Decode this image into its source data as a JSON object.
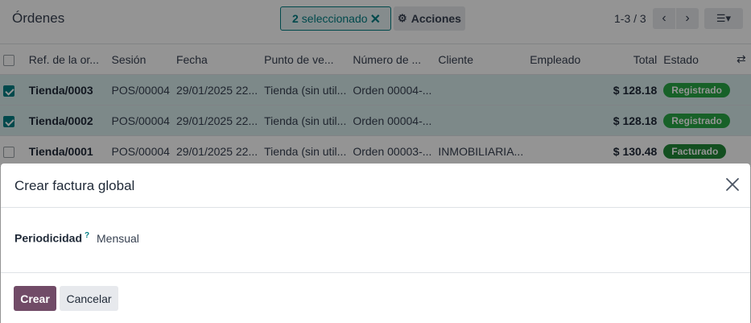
{
  "topbar": {
    "title": "Órdenes",
    "selection_count": "2",
    "selection_label": "seleccionado",
    "clear_selection_icon": "close-icon",
    "actions_label": "Acciones",
    "actions_icon": "gear-icon",
    "pager_text": "1-3 / 3",
    "view_icon": "list-view-icon"
  },
  "table": {
    "headers": [
      "Ref. de la or...",
      "Sesión",
      "Fecha",
      "Punto de ve...",
      "Número de ...",
      "Cliente",
      "Empleado",
      "Total",
      "Estado"
    ],
    "rows": [
      {
        "selected": true,
        "ref": "Tienda/0003",
        "session": "POS/00004",
        "date": "29/01/2025 22...",
        "pos": "Tienda (sin util...",
        "number": "Orden 00004-...",
        "client": "",
        "employee": "",
        "total": "$ 128.18",
        "status": "Registrado"
      },
      {
        "selected": true,
        "ref": "Tienda/0002",
        "session": "POS/00004",
        "date": "29/01/2025 22...",
        "pos": "Tienda (sin util...",
        "number": "Orden 00004-...",
        "client": "",
        "employee": "",
        "total": "$ 128.18",
        "status": "Registrado"
      },
      {
        "selected": false,
        "ref": "Tienda/0001",
        "session": "POS/00004",
        "date": "29/01/2025 22...",
        "pos": "Tienda (sin util...",
        "number": "Orden 00003-...",
        "client": "INMOBILIARIA...",
        "employee": "",
        "total": "$ 130.48",
        "status": "Facturado"
      }
    ]
  },
  "modal": {
    "title": "Crear factura global",
    "field_label": "Periodicidad",
    "field_help": "?",
    "field_value": "Mensual",
    "primary_label": "Crear",
    "secondary_label": "Cancelar"
  },
  "colors": {
    "primary": "#714b67",
    "accent": "#017e84",
    "status_green": "#28a745"
  }
}
